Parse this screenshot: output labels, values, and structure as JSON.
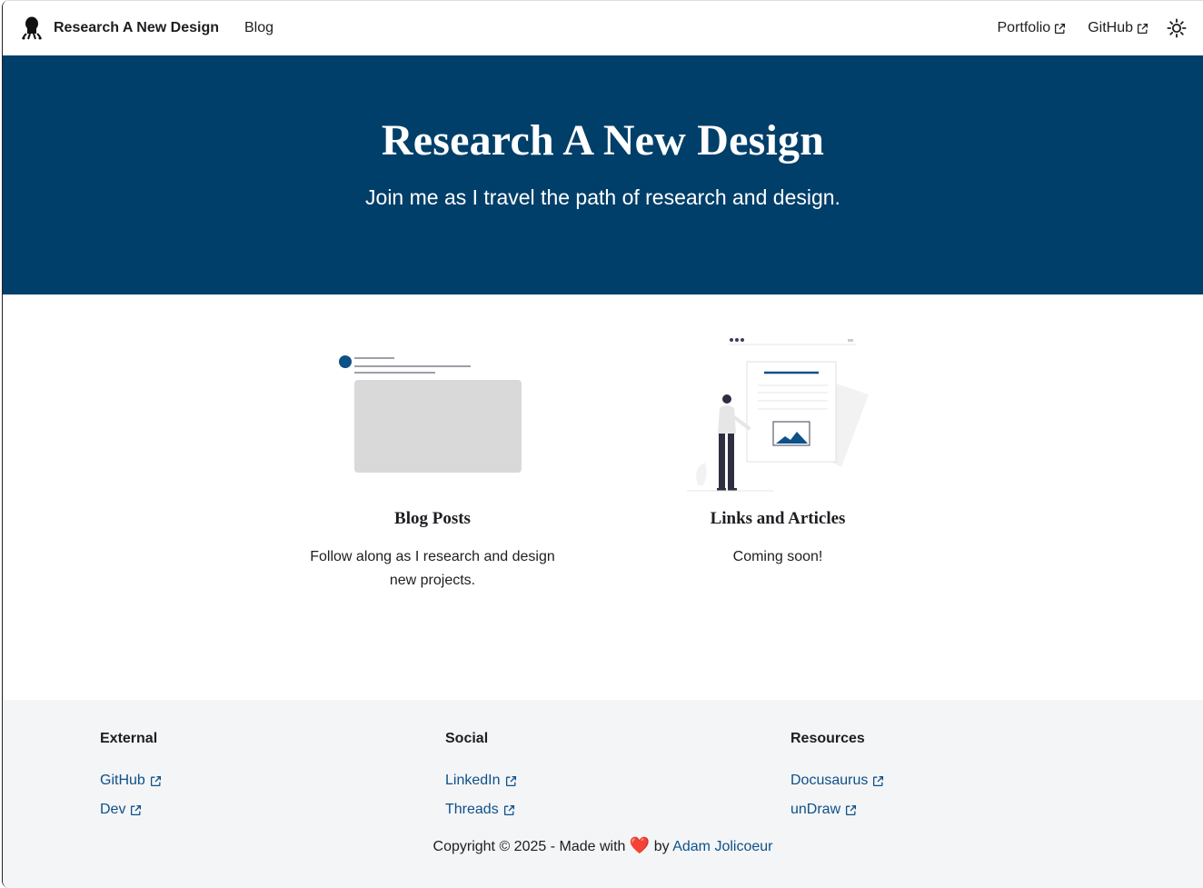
{
  "navbar": {
    "brand_title": "Research A New Design",
    "blog_label": "Blog",
    "portfolio_label": "Portfolio",
    "github_label": "GitHub"
  },
  "hero": {
    "title": "Research A New Design",
    "subtitle": "Join me as I travel the path of research and design."
  },
  "features": [
    {
      "title": "Blog Posts",
      "description": "Follow along as I research and design new projects."
    },
    {
      "title": "Links and Articles",
      "description": "Coming soon!"
    }
  ],
  "footer": {
    "columns": [
      {
        "title": "External",
        "links": [
          {
            "label": "GitHub"
          },
          {
            "label": "Dev"
          }
        ]
      },
      {
        "title": "Social",
        "links": [
          {
            "label": "LinkedIn"
          },
          {
            "label": "Threads"
          }
        ]
      },
      {
        "title": "Resources",
        "links": [
          {
            "label": "Docusaurus"
          },
          {
            "label": "unDraw"
          }
        ]
      }
    ],
    "copyright_prefix": "Copyright © 2025 - Made with",
    "heart": "❤️",
    "by_label": "by",
    "author": "Adam Jolicoeur"
  },
  "colors": {
    "hero_bg": "#003f69",
    "link": "#0e5088",
    "footer_bg": "#f4f5f7",
    "accent": "#0e5088"
  },
  "icons": [
    "logo-icon",
    "external-link-icon",
    "sun-icon"
  ]
}
